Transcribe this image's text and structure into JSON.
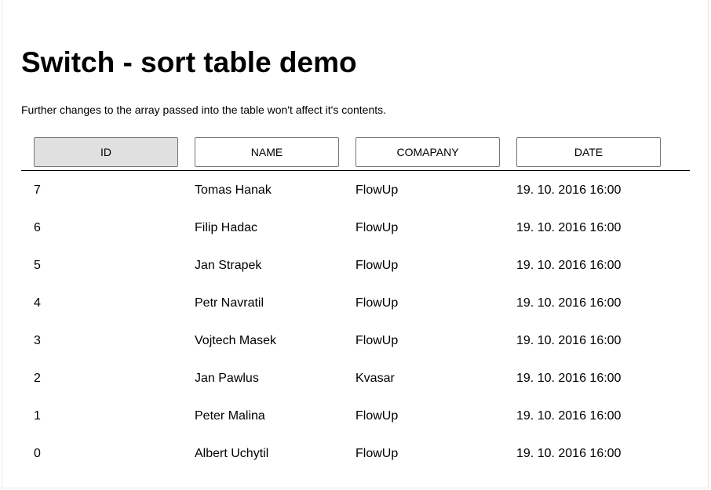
{
  "page": {
    "title": "Switch - sort table demo",
    "description": "Further changes to the array passed into the table won't affect it's contents."
  },
  "table": {
    "active_sort": "ID",
    "headers": [
      "ID",
      "NAME",
      "COMAPANY",
      "DATE"
    ],
    "rows": [
      {
        "id": "7",
        "name": "Tomas Hanak",
        "company": "FlowUp",
        "date": "19. 10. 2016 16:00"
      },
      {
        "id": "6",
        "name": "Filip Hadac",
        "company": "FlowUp",
        "date": "19. 10. 2016 16:00"
      },
      {
        "id": "5",
        "name": "Jan Strapek",
        "company": "FlowUp",
        "date": "19. 10. 2016 16:00"
      },
      {
        "id": "4",
        "name": "Petr Navratil",
        "company": "FlowUp",
        "date": "19. 10. 2016 16:00"
      },
      {
        "id": "3",
        "name": "Vojtech Masek",
        "company": "FlowUp",
        "date": "19. 10. 2016 16:00"
      },
      {
        "id": "2",
        "name": "Jan Pawlus",
        "company": "Kvasar",
        "date": "19. 10. 2016 16:00"
      },
      {
        "id": "1",
        "name": "Peter Malina",
        "company": "FlowUp",
        "date": "19. 10. 2016 16:00"
      },
      {
        "id": "0",
        "name": "Albert Uchytil",
        "company": "FlowUp",
        "date": "19. 10. 2016 16:00"
      }
    ]
  },
  "colors": {
    "active_button_bg": "#e0e0e0",
    "button_border": "#767676",
    "header_rule": "#000000"
  }
}
